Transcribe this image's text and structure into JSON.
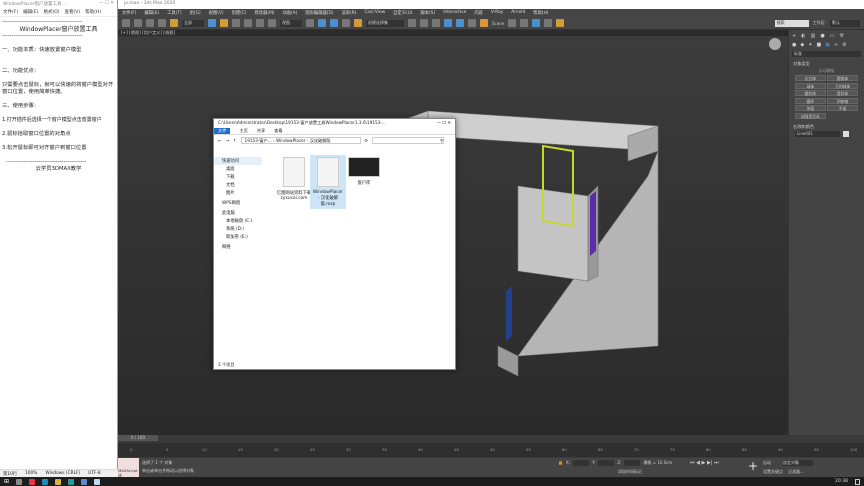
{
  "notepad": {
    "title": "WindowPlacer窗户放置工具 ...",
    "menu": [
      "文件(F)",
      "编辑(E)",
      "格式(O)",
      "查看(V)",
      "帮助(H)"
    ],
    "lines": [
      "------------------------------------------",
      "WindowPlacer窗户放置工具",
      "------------------------------------------",
      "一、功能本质：快速放置窗户模型",
      "二、功能优点：",
      "只需要点击鼠标，就可以快速的将窗户模型对齐窗口位置，使用简单快捷。",
      "三、使用步骤：",
      "1.打开插件后选择一个窗户模型点击放置窗户",
      "2.鼠标拾取窗口位置的对角点",
      "3.松开鼠标即可对齐窗户到窗口位置",
      "------------------------------------------",
      "云学员3DMAX教学"
    ],
    "status": [
      "第10行",
      "100%",
      "Windows (CRLF)",
      "UTF-8"
    ]
  },
  "max": {
    "title": "jo.max - 3ds Max 2020",
    "menu": [
      "文件(F)",
      "编辑(E)",
      "工具(T)",
      "组(G)",
      "视图(V)",
      "创建(C)",
      "修改器(M)",
      "动画(A)",
      "图形编辑器(D)",
      "渲染(R)",
      "Civil View",
      "自定义(U)",
      "脚本(S)",
      "Interactive",
      "内容",
      "V-Ray",
      "Arnold",
      "帮助(H)"
    ],
    "toolbar": {
      "filter": "全部",
      "view": "视图",
      "selset": "创建选择集",
      "scene": "Scene"
    },
    "workspace": {
      "search": "搜索",
      "label": "工作区:",
      "value": "默认"
    },
    "viewport_label": "[+] [透视] [用户定义] [线框]",
    "cmd": {
      "dropdown": "标准",
      "rollout1": "对象类型",
      "autogrid": "自动栅格",
      "buttons": [
        "长方体",
        "圆锥体",
        "球体",
        "几何球体",
        "圆柱体",
        "管状体",
        "圆环",
        "四棱锥",
        "茶壶",
        "平面",
        "加强型文本"
      ],
      "rollout2": "名称和颜色",
      "name": "Line001"
    },
    "timeline": {
      "frame": "0 / 100",
      "ticks": [
        "0",
        "5",
        "10",
        "15",
        "20",
        "25",
        "30",
        "35",
        "40",
        "45",
        "50",
        "55",
        "60",
        "65",
        "70",
        "75",
        "80",
        "85",
        "90",
        "95",
        "100"
      ]
    },
    "status": {
      "maxscript": "MAXScript 迷",
      "selected": "选择了 1 个 对象",
      "hint": "单击或单击并拖动以选择对象",
      "x": "X:",
      "y": "Y:",
      "z": "Z:",
      "grid": "栅格 = 10.0cm",
      "addtime": "添加时间标记",
      "autokey": "自动",
      "setkey": "设置关键点",
      "selobj": "选定对象",
      "filters": "过滤器..."
    }
  },
  "explorer": {
    "path": "C:\\Users\\Administrator\\Desktop\\19153-窗户放置工具WindowPlacer1.3.0\\19153-...",
    "ribbon": [
      "文件",
      "主页",
      "共享",
      "查看"
    ],
    "crumbs": [
      "19153-窗户...",
      "WindowPlacer - 汉化破解版"
    ],
    "nav": [
      "快速访问",
      "桌面",
      "下载",
      "文档",
      "图片",
      "WPS网盘",
      "此电脑",
      "本地磁盘 (C:)",
      "系统 (D:)",
      "新加卷 (E:)",
      "网络"
    ],
    "files": [
      "亿图网站资料下载zyxucai.com",
      "WindowPlacer - 汉化破解版.mzp",
      "窗户库"
    ],
    "count": "3 个项目"
  },
  "taskbar": {
    "time": "20:38"
  }
}
